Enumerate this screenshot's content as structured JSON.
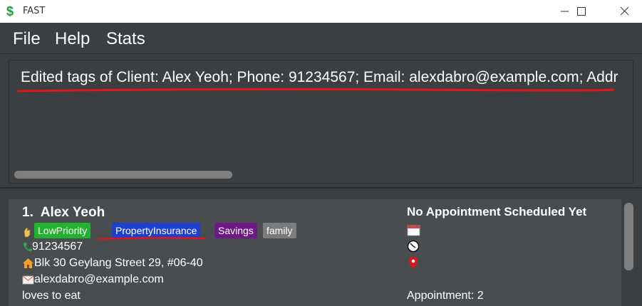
{
  "window": {
    "title": "FAST",
    "app_icon": "dollar-icon"
  },
  "menu": {
    "file": "File",
    "help": "Help",
    "stats": "Stats"
  },
  "result": {
    "message": "Edited tags of Client: Alex Yeoh; Phone: 91234567; Email: alexdabro@example.com; Addr"
  },
  "persons": [
    {
      "index": "1.",
      "name": "Alex Yeoh",
      "tags": [
        {
          "label": "LowPriority",
          "color": "#23b22f"
        },
        {
          "label": "PropertyInsurance",
          "color": "#1f3fd1"
        },
        {
          "label": "Savings",
          "color": "#6d1a86"
        },
        {
          "label": "family",
          "color": "#7b7b7b"
        }
      ],
      "phone": "91234567",
      "address": "Blk 30 Geylang Street 29, #06-40",
      "email": "alexdabro@example.com",
      "remark": "loves to eat",
      "appointment_status": "No Appointment Scheduled Yet",
      "appointment_count": "Appointment: 2"
    }
  ],
  "colors": {
    "background": "#3c3f41",
    "card": "#4a4d50",
    "annotation_red": "#e0161c"
  }
}
